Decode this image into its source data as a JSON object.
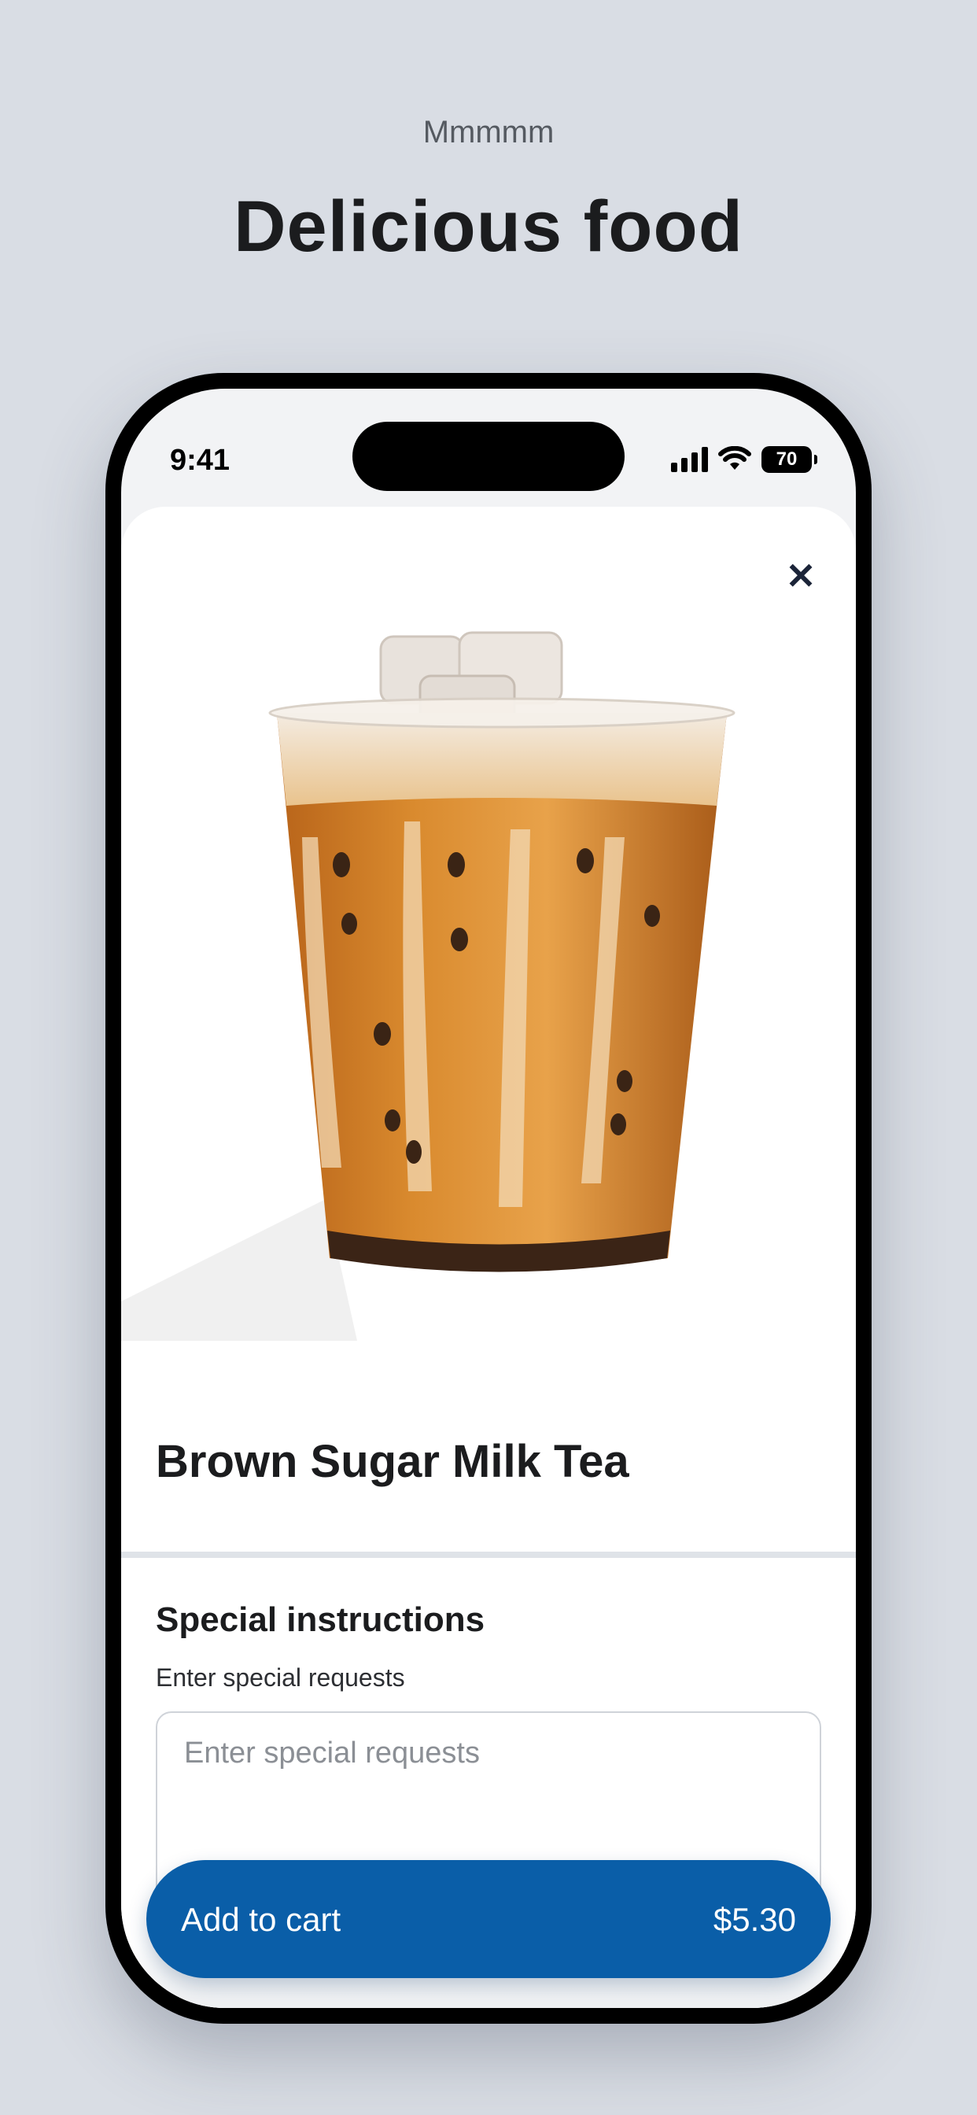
{
  "header": {
    "eyebrow": "Mmmmm",
    "title": "Delicious food"
  },
  "status_bar": {
    "time": "9:41",
    "battery": "70",
    "icons": [
      "signal-icon",
      "wifi-icon",
      "battery-icon"
    ]
  },
  "product": {
    "name": "Brown Sugar Milk Tea",
    "image_icon": "milk-tea-cup-image"
  },
  "instructions": {
    "title": "Special instructions",
    "subtitle": "Enter special requests",
    "placeholder": "Enter special requests"
  },
  "cart_button": {
    "label": "Add to cart",
    "price": "$5.30"
  },
  "colors": {
    "background": "#d9dde4",
    "accent": "#0a5ea8",
    "text": "#1b1c1e"
  }
}
